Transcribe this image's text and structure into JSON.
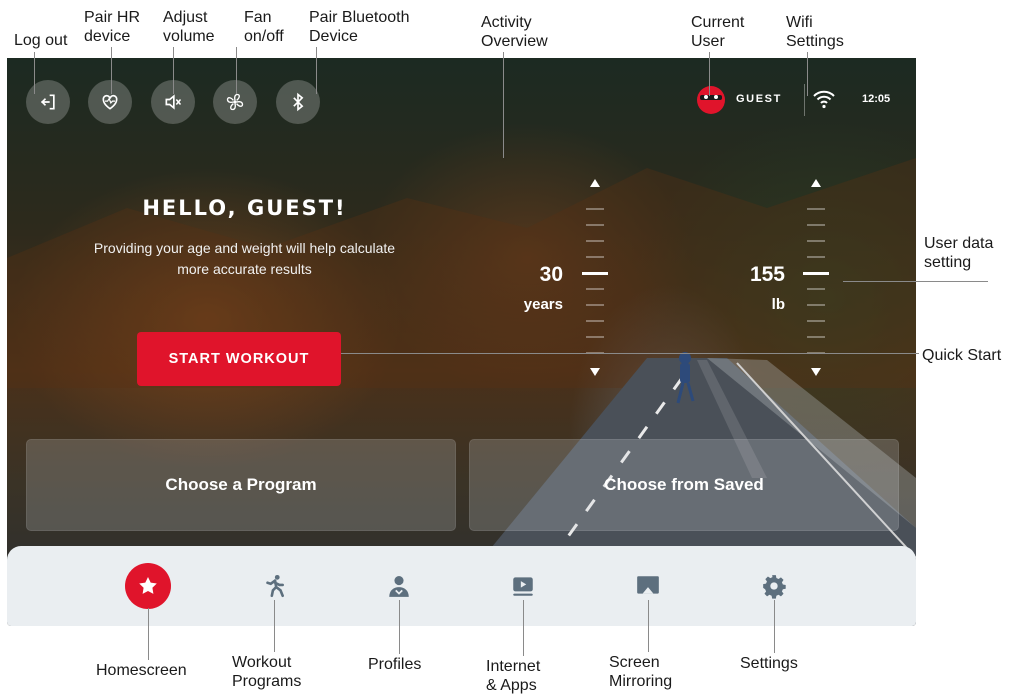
{
  "annotations": {
    "log_out": "Log out",
    "pair_hr": "Pair HR\ndevice",
    "adjust_volume": "Adjust\nvolume",
    "fan": "Fan\non/off",
    "pair_bluetooth": "Pair Bluetooth\nDevice",
    "activity_overview": "Activity\nOverview",
    "current_user": "Current\nUser",
    "wifi_settings": "Wifi\nSettings",
    "user_data_setting": "User data\nsetting",
    "quick_start": "Quick Start",
    "homescreen": "Homescreen",
    "workout_programs": "Workout\nPrograms",
    "profiles": "Profiles",
    "internet_apps": "Internet\n& Apps",
    "screen_mirroring": "Screen\nMirroring",
    "settings": "Settings"
  },
  "status": {
    "user": "GUEST",
    "time": "12:05"
  },
  "greeting": {
    "title": "HELLO, GUEST!",
    "hint": "Providing your age and weight will help calculate more accurate results"
  },
  "quick_start": {
    "label": "START WORKOUT"
  },
  "age": {
    "value": "30",
    "unit": "years"
  },
  "weight": {
    "value": "155",
    "unit": "lb"
  },
  "cards": {
    "program": "Choose a Program",
    "saved": "Choose from Saved"
  },
  "colors": {
    "accent": "#e0142b",
    "navbar": "#eaeef1",
    "nav_icon": "#5d6f7e"
  },
  "icons": {
    "top": [
      "logout-icon",
      "heart-rate-icon",
      "volume-mute-icon",
      "fan-icon",
      "bluetooth-icon"
    ],
    "status": [
      "user-avatar-icon",
      "wifi-icon"
    ],
    "nav": [
      "star-icon",
      "runner-icon",
      "person-icon",
      "play-icon",
      "screen-cast-icon",
      "gear-icon"
    ]
  }
}
